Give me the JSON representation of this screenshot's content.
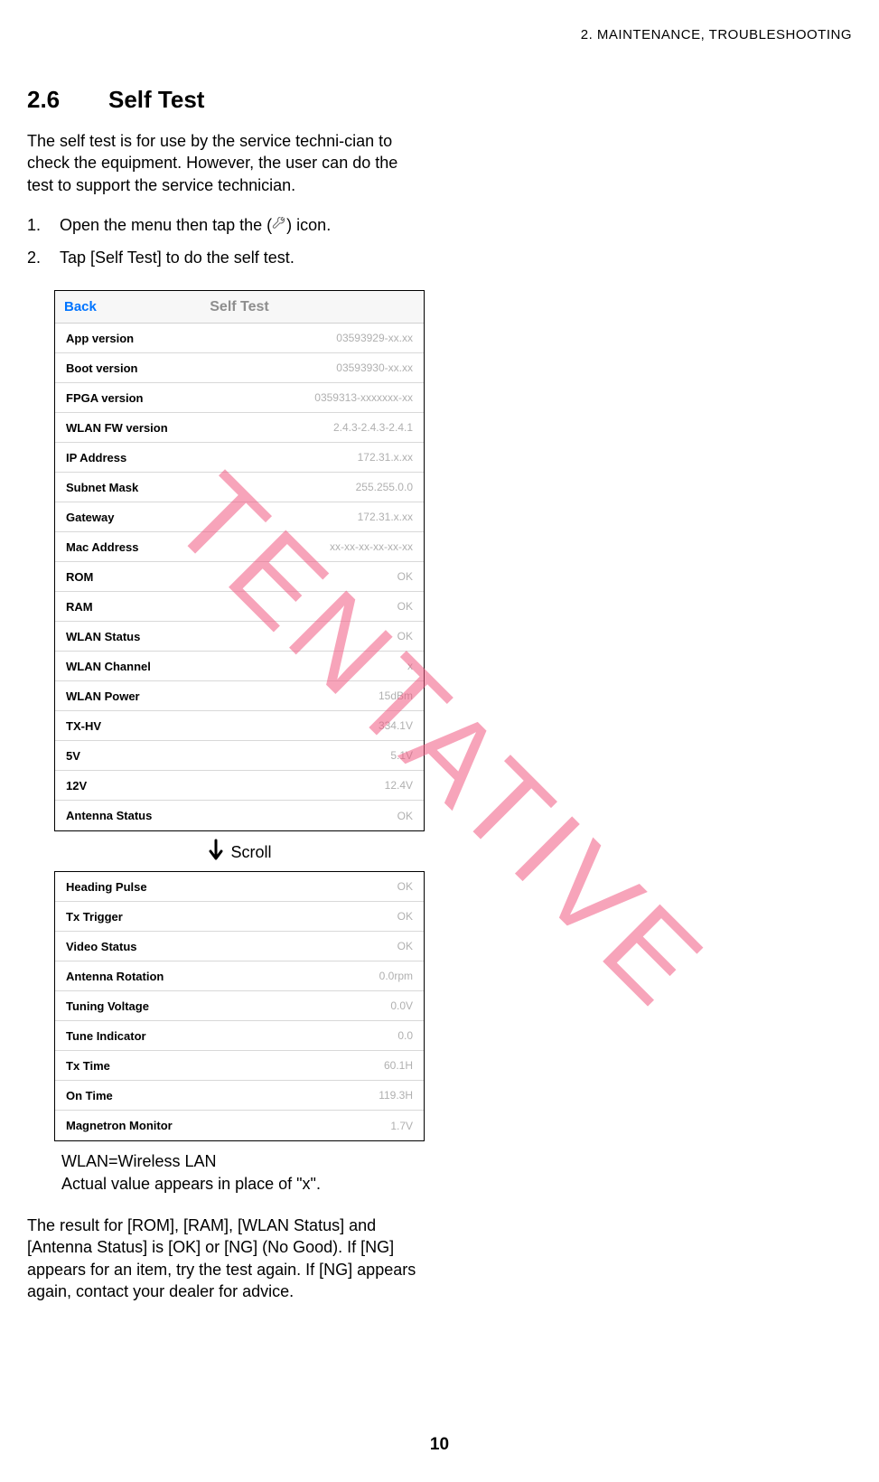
{
  "header": {
    "chapter": "2.  MAINTENANCE, TROUBLESHOOTING"
  },
  "section": {
    "number": "2.6",
    "title": "Self Test"
  },
  "intro": "The self test is for use by the service techni-cian to check the equipment. However, the user can do the test to support the service technician.",
  "steps": {
    "s1_pre": "Open the menu then tap the (",
    "s1_post": ") icon.",
    "s2": "Tap [Self Test] to do the self test."
  },
  "panel1": {
    "back": "Back",
    "title": "Self Test",
    "rows": [
      {
        "label": "App version",
        "value": "03593929-xx.xx"
      },
      {
        "label": "Boot version",
        "value": "03593930-xx.xx"
      },
      {
        "label": "FPGA version",
        "value": "0359313-xxxxxxx-xx"
      },
      {
        "label": "WLAN FW version",
        "value": "2.4.3-2.4.3-2.4.1"
      },
      {
        "label": "IP Address",
        "value": "172.31.x.xx"
      },
      {
        "label": "Subnet Mask",
        "value": "255.255.0.0"
      },
      {
        "label": "Gateway",
        "value": "172.31.x.xx"
      },
      {
        "label": "Mac Address",
        "value": "xx-xx-xx-xx-xx-xx"
      },
      {
        "label": "ROM",
        "value": "OK"
      },
      {
        "label": "RAM",
        "value": "OK"
      },
      {
        "label": "WLAN Status",
        "value": "OK"
      },
      {
        "label": "WLAN Channel",
        "value": "x"
      },
      {
        "label": "WLAN Power",
        "value": "15dBm"
      },
      {
        "label": "TX-HV",
        "value": "334.1V"
      },
      {
        "label": "5V",
        "value": "5.1V"
      },
      {
        "label": "12V",
        "value": "12.4V"
      },
      {
        "label": "Antenna Status",
        "value": "OK"
      }
    ]
  },
  "scroll_label": "Scroll",
  "panel2": {
    "rows": [
      {
        "label": "Heading Pulse",
        "value": "OK"
      },
      {
        "label": "Tx Trigger",
        "value": "OK"
      },
      {
        "label": "Video Status",
        "value": "OK"
      },
      {
        "label": "Antenna Rotation",
        "value": "0.0rpm"
      },
      {
        "label": "Tuning Voltage",
        "value": "0.0V"
      },
      {
        "label": "Tune Indicator",
        "value": "0.0"
      },
      {
        "label": "Tx Time",
        "value": "60.1H"
      },
      {
        "label": "On Time",
        "value": "119.3H"
      },
      {
        "label": "Magnetron Monitor",
        "value": "1.7V"
      }
    ]
  },
  "footnote": {
    "line1": "WLAN=Wireless LAN",
    "line2": "Actual value appears in place of \"x\"."
  },
  "result_para": "The result for [ROM], [RAM], [WLAN Status] and [Antenna Status] is [OK] or [NG] (No Good). If [NG] appears for an item, try the test again. If [NG] appears again, contact your dealer for advice.",
  "page_number": "10",
  "watermark": "TENTATIVE"
}
